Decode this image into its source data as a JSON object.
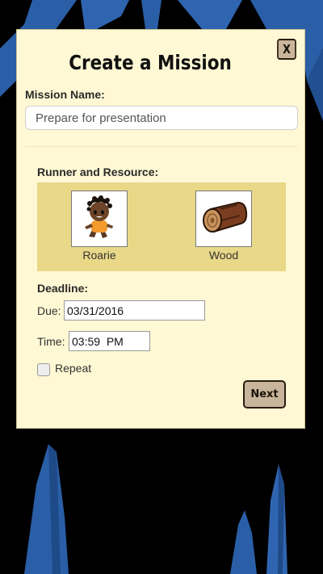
{
  "dialog": {
    "title": "Create a Mission",
    "close_label": "X",
    "mission_name_label": "Mission Name:",
    "mission_name_value": "Prepare for presentation",
    "runner_resource_label": "Runner and Resource:",
    "runner": {
      "name": "Roarie",
      "icon": "runner-avatar-icon"
    },
    "resource": {
      "name": "Wood",
      "icon": "wood-log-icon"
    },
    "deadline_label": "Deadline:",
    "due_label": "Due:",
    "due_value": "03/31/2016",
    "time_label": "Time:",
    "time_value": "03:59  PM",
    "repeat_label": "Repeat",
    "repeat_checked": false,
    "next_label": "Next"
  },
  "colors": {
    "background": "#000000",
    "crystal": "#2a5ea6",
    "panel": "#fff8d4",
    "resource_box": "#e8d888",
    "button": "#c8b59c",
    "button_border": "#2a1c10"
  }
}
